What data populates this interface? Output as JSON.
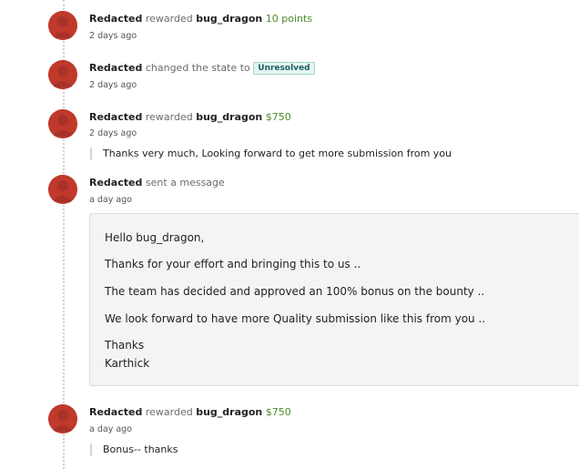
{
  "activity": [
    {
      "actor": "Redacted",
      "verb": "rewarded",
      "target": "bug_dragon",
      "amount": "10 points",
      "time": "2 days ago"
    },
    {
      "actor": "Redacted",
      "verb": "changed the state to",
      "state": "Unresolved",
      "time": "2 days ago"
    },
    {
      "actor": "Redacted",
      "verb": "rewarded",
      "target": "bug_dragon",
      "amount": "$750",
      "time": "2 days ago",
      "comment": "Thanks very much, Looking forward to get more submission from you"
    },
    {
      "actor": "Redacted",
      "verb": "sent a message",
      "time": "a day ago",
      "message": {
        "greeting": "Hello bug_dragon,",
        "line1": "Thanks for your effort and bringing this to us ..",
        "line2": "The team has decided and approved an 100% bonus on the bounty ..",
        "line3": "We look forward to have more Quality submission like this from you ..",
        "signoff": "Thanks",
        "signature": "Karthick"
      }
    },
    {
      "actor": "Redacted",
      "verb": "rewarded",
      "target": "bug_dragon",
      "amount": "$750",
      "time": "a day ago",
      "comment": "Bonus-- thanks"
    }
  ],
  "colors": {
    "avatar": "#c0392b",
    "amount": "#4a8a28",
    "badge_bg": "#e4f5f3",
    "badge_border": "#9fd3cc"
  }
}
